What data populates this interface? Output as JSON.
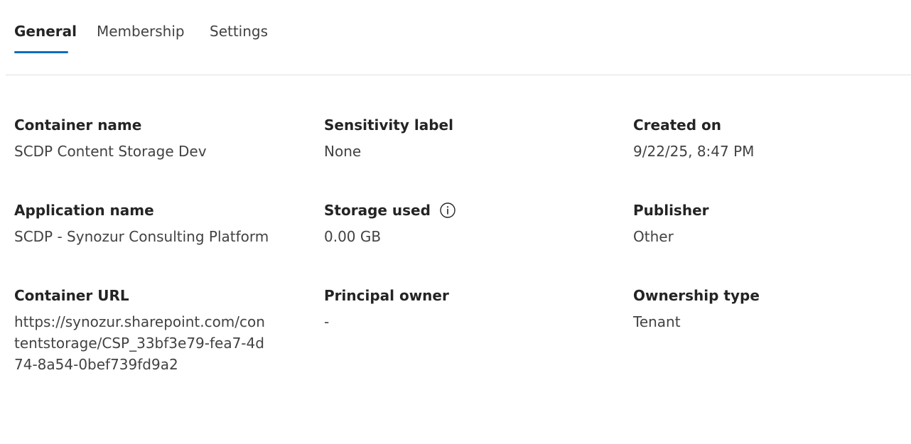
{
  "tabs": {
    "general": "General",
    "membership": "Membership",
    "settings": "Settings"
  },
  "accent_color": "#0f6cbd",
  "details": {
    "container_name": {
      "label": "Container name",
      "value": "SCDP Content Storage Dev"
    },
    "sensitivity_label": {
      "label": "Sensitivity label",
      "value": "None"
    },
    "created_on": {
      "label": "Created on",
      "value": "9/22/25, 8:47 PM"
    },
    "application_name": {
      "label": "Application name",
      "value": "SCDP - Synozur Consulting Platform"
    },
    "storage_used": {
      "label": "Storage used",
      "value": "0.00 GB",
      "icon": "info-icon"
    },
    "publisher": {
      "label": "Publisher",
      "value": "Other"
    },
    "container_url": {
      "label": "Container URL",
      "value": "https://synozur.sharepoint.com/contentstorage/CSP_33bf3e79-fea7-4d74-8a54-0bef739fd9a2"
    },
    "principal_owner": {
      "label": "Principal owner",
      "value": "-"
    },
    "ownership_type": {
      "label": "Ownership type",
      "value": "Tenant"
    }
  }
}
